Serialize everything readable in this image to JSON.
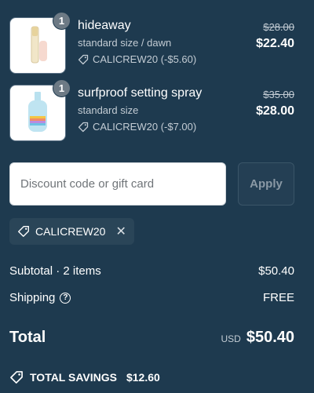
{
  "items": [
    {
      "quantity": "1",
      "name": "hideaway",
      "variant": "standard size / dawn",
      "discount": "CALICREW20 (-$5.60)",
      "original_price": "$28.00",
      "price": "$22.40"
    },
    {
      "quantity": "1",
      "name": "surfproof setting spray",
      "variant": "standard size",
      "discount": "CALICREW20 (-$7.00)",
      "original_price": "$35.00",
      "price": "$28.00"
    }
  ],
  "discount": {
    "placeholder": "Discount code or gift card",
    "apply_label": "Apply",
    "applied_code": "CALICREW20"
  },
  "summary": {
    "subtotal_label": "Subtotal · 2 items",
    "subtotal_value": "$50.40",
    "shipping_label": "Shipping",
    "shipping_value": "FREE",
    "total_label": "Total",
    "currency": "USD",
    "total_value": "$50.40",
    "savings_label": "TOTAL SAVINGS",
    "savings_value": "$12.60"
  },
  "colors": {
    "background": "#1e3a4f",
    "text": "#ffffff",
    "muted_text": "#c3ccd4"
  }
}
